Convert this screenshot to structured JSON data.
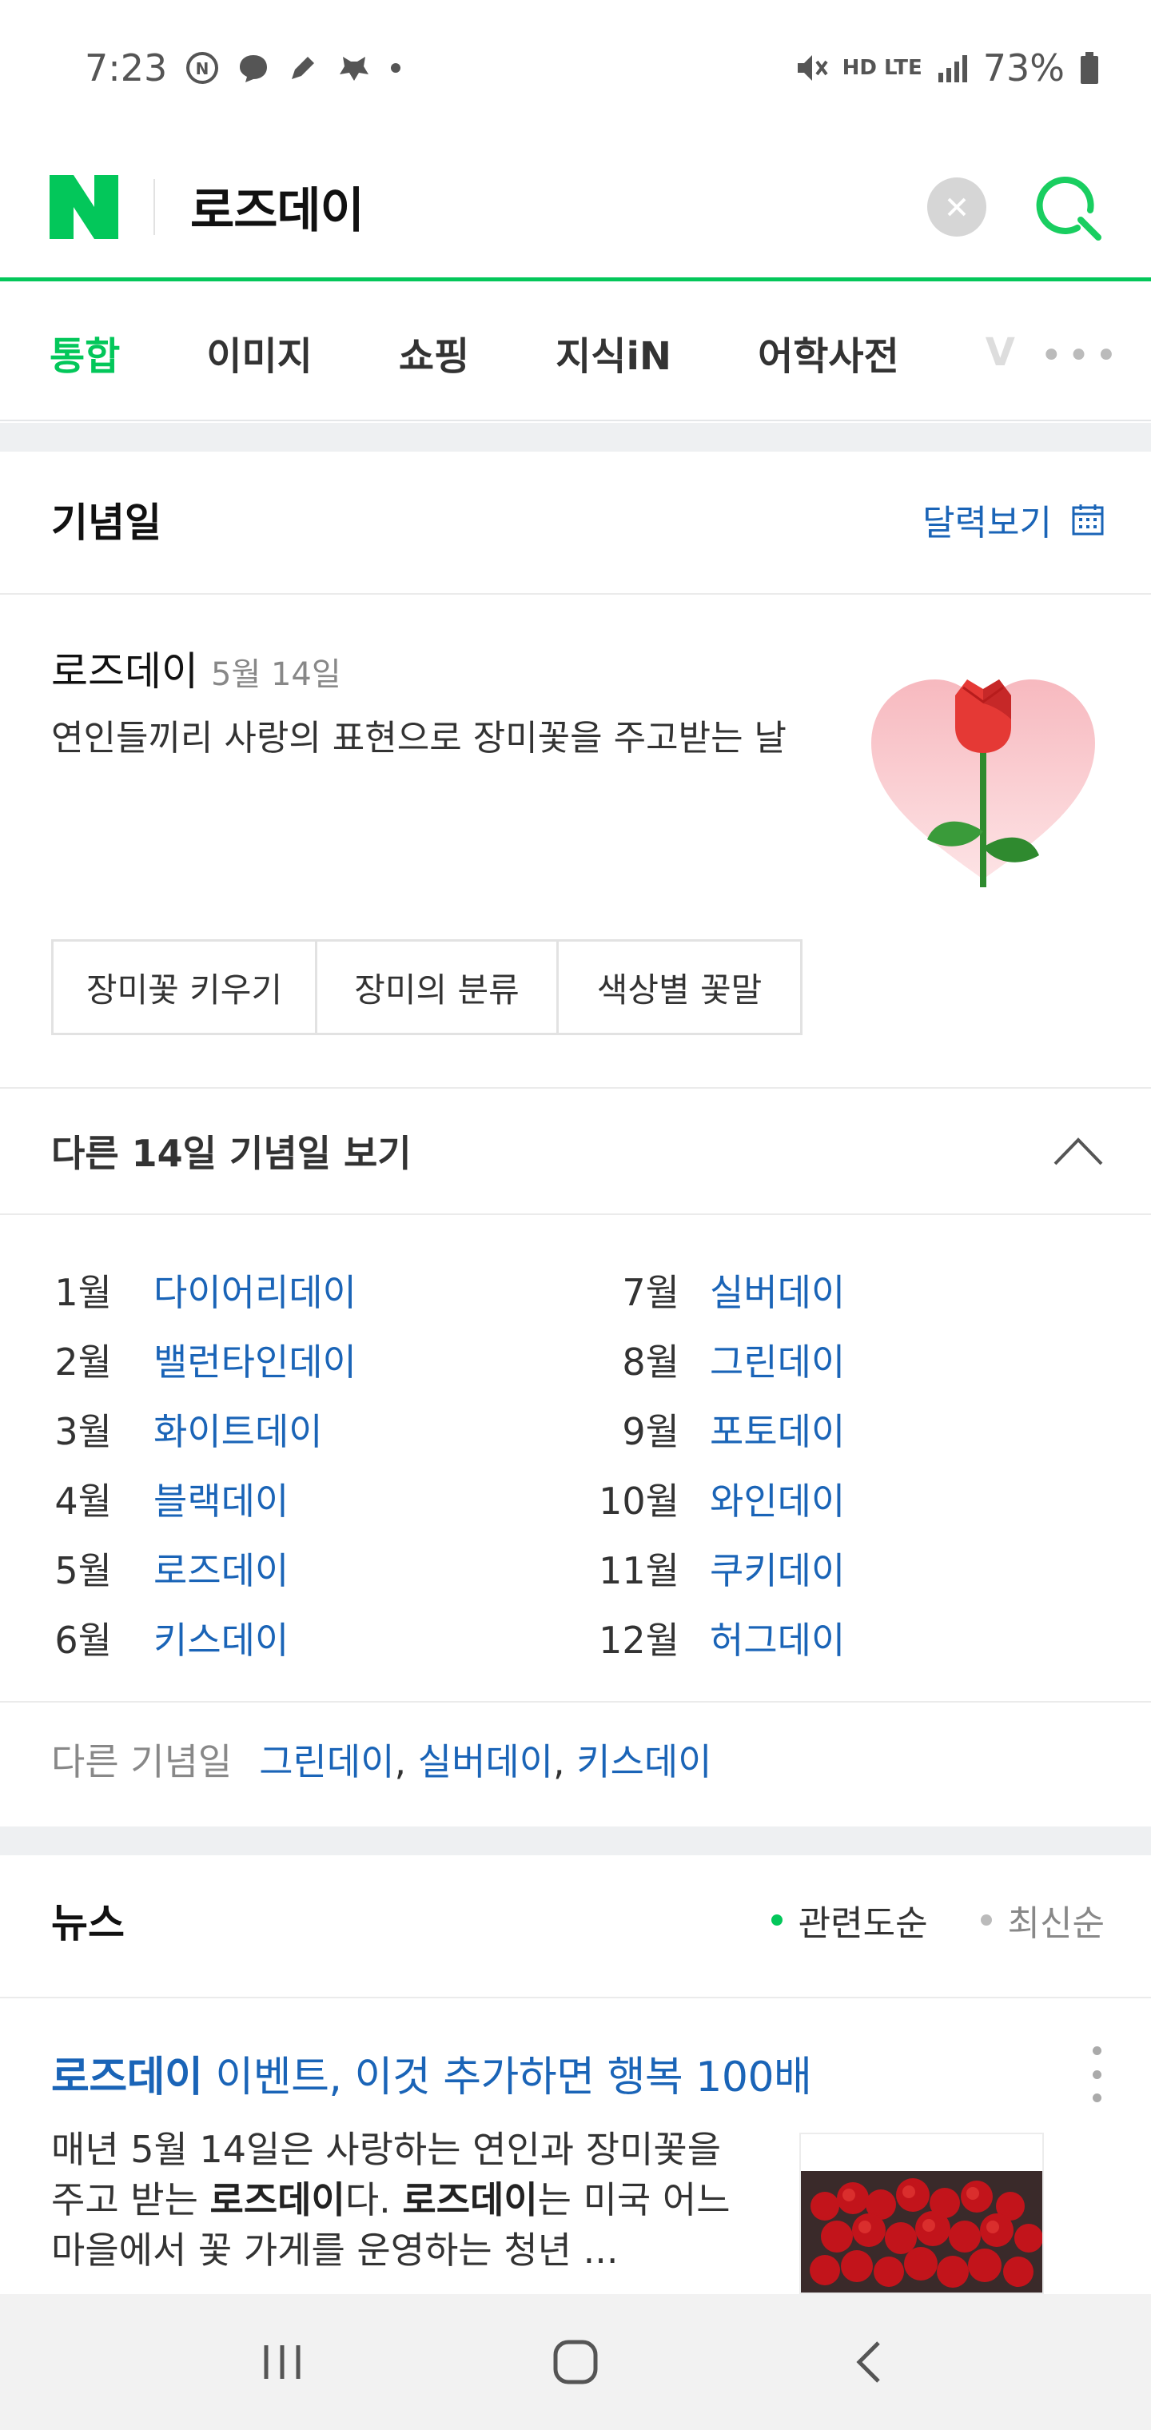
{
  "status": {
    "time": "7:23",
    "battery": "73%",
    "network": "HD LTE"
  },
  "search": {
    "logo": "N",
    "query": "로즈데이"
  },
  "tabs": [
    {
      "label": "통합",
      "active": true
    },
    {
      "label": "이미지"
    },
    {
      "label": "쇼핑"
    },
    {
      "label": "지식iN"
    },
    {
      "label": "어학사전"
    },
    {
      "label": "V"
    }
  ],
  "anniversary": {
    "section_title": "기념일",
    "calendar_link": "달력보기",
    "name": "로즈데이",
    "date": "5월 14일",
    "description": "연인들끼리 사랑의 표현으로 장미꽃을 주고받는 날",
    "chips": [
      "장미꽃 키우기",
      "장미의 분류",
      "색상별 꽃말"
    ]
  },
  "other14": {
    "title": "다른 14일 기념일 보기",
    "left": [
      {
        "month": "1월",
        "name": "다이어리데이"
      },
      {
        "month": "2월",
        "name": "밸런타인데이"
      },
      {
        "month": "3월",
        "name": "화이트데이"
      },
      {
        "month": "4월",
        "name": "블랙데이"
      },
      {
        "month": "5월",
        "name": "로즈데이"
      },
      {
        "month": "6월",
        "name": "키스데이"
      }
    ],
    "right": [
      {
        "month": "7월",
        "name": "실버데이"
      },
      {
        "month": "8월",
        "name": "그린데이"
      },
      {
        "month": "9월",
        "name": "포토데이"
      },
      {
        "month": "10월",
        "name": "와인데이"
      },
      {
        "month": "11월",
        "name": "쿠키데이"
      },
      {
        "month": "12월",
        "name": "허그데이"
      }
    ]
  },
  "other_anniversaries": {
    "label": "다른 기념일",
    "links": [
      "그린데이",
      "실버데이",
      "키스데이"
    ]
  },
  "news": {
    "section_title": "뉴스",
    "sort_relevance": "관련도순",
    "sort_latest": "최신순",
    "article": {
      "title_highlight": "로즈데이",
      "title_rest": " 이벤트, 이것 추가하면 행복 100배",
      "body_1": "매년 5월 14일은 사랑하는 연인과 장미꽃을 주고 받는 ",
      "body_b1": "로즈데이",
      "body_2": "다. ",
      "body_b2": "로즈데이",
      "body_3": "는 미국 어느 마을에서 꽃 가게를 운영하는 청년 ..."
    }
  },
  "colors": {
    "naver_green": "#03c75a",
    "link_blue": "#1a64b7"
  }
}
